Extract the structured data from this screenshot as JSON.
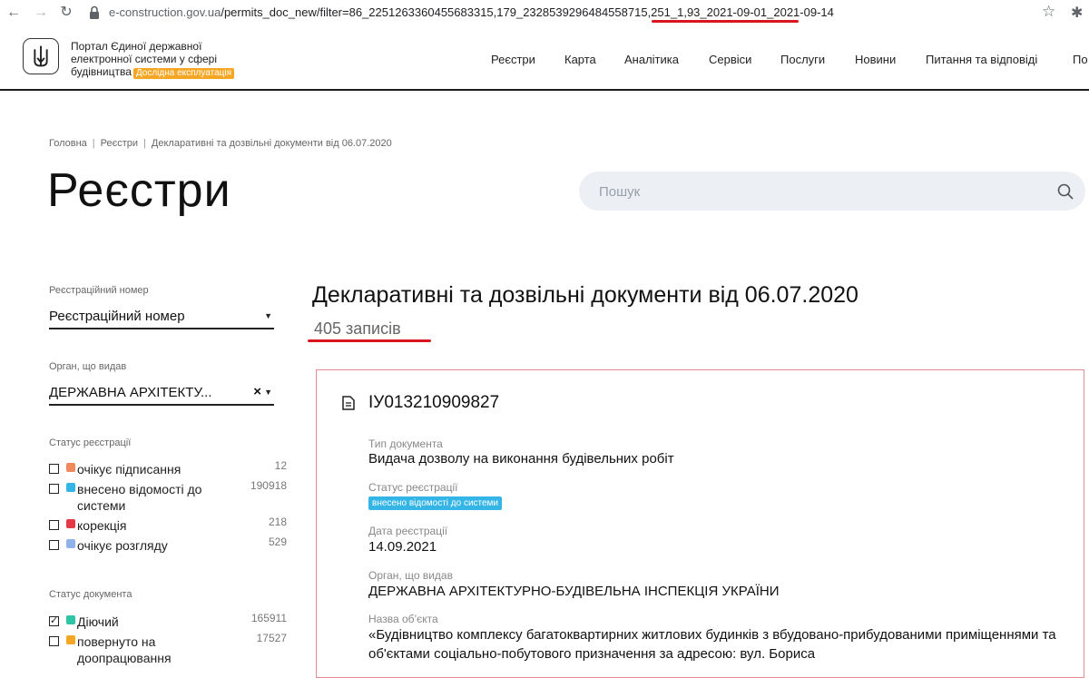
{
  "browser": {
    "url_host": "e-construction.gov.ua",
    "url_path": "/permits_doc_new/filter=86_2251263360455683315,179_2328539296484558715,251_1,93_2021-09-01_2021-09-14"
  },
  "header": {
    "portal_name_line1": "Портал Єдиної державної",
    "portal_name_line2": "електронної системи у сфері",
    "portal_name_line3": "будівництва",
    "badge": "Дослідна експлуатація",
    "nav": [
      "Реєстри",
      "Карта",
      "Аналітика",
      "Сервіси",
      "Послуги",
      "Новини",
      "Питання та відповіді",
      "По"
    ]
  },
  "breadcrumb": [
    "Головна",
    "Реєстри",
    "Декларативні та дозвільні документи від 06.07.2020"
  ],
  "page_title": "Реєстри",
  "search": {
    "placeholder": "Пошук"
  },
  "filters": {
    "reg_number": {
      "label": "Реєстраційний номер",
      "value": "Реєстраційний номер"
    },
    "organ": {
      "label": "Орган, що видав",
      "value": "ДЕРЖАВНА АРХІТЕКТУ..."
    },
    "reg_status": {
      "label": "Статус реєстрації",
      "items": [
        {
          "text": "очікує підписання",
          "count": "12",
          "color": "#f08a5d",
          "checked": false
        },
        {
          "text": "внесено відомості до системи",
          "count": "190918",
          "color": "#35b5e5",
          "checked": false
        },
        {
          "text": "корекція",
          "count": "218",
          "color": "#e63946",
          "checked": false
        },
        {
          "text": "очікує розгляду",
          "count": "529",
          "color": "#8fb3e8",
          "checked": false
        }
      ]
    },
    "doc_status": {
      "label": "Статус документа",
      "items": [
        {
          "text": "Діючий",
          "count": "165911",
          "color": "#2ec4a6",
          "checked": true
        },
        {
          "text": "повернуто на доопрацювання",
          "count": "17527",
          "color": "#f5a623",
          "checked": false
        }
      ]
    }
  },
  "results": {
    "section_title": "Декларативні та дозвільні документи від 06.07.2020",
    "count_text": "405 записів",
    "card": {
      "number": "ІУ013210909827",
      "doc_type_label": "Тип документа",
      "doc_type": "Видача дозволу на виконання будівельних робіт",
      "reg_status_label": "Статус реєстрації",
      "reg_status": "внесено відомості до системи",
      "reg_date_label": "Дата реєстрації",
      "reg_date": "14.09.2021",
      "organ_label": "Орган, що видав",
      "organ": "ДЕРЖАВНА АРХІТЕКТУРНО-БУДІВЕЛЬНА ІНСПЕКЦІЯ УКРАЇНИ",
      "object_label": "Назва об’єкта",
      "object": "«Будівництво комплексу багатоквартирних житлових будинків з вбудовано-прибудованими приміщеннями та об'єктами соціально-побутового призначення за адресою: вул. Бориса"
    }
  }
}
